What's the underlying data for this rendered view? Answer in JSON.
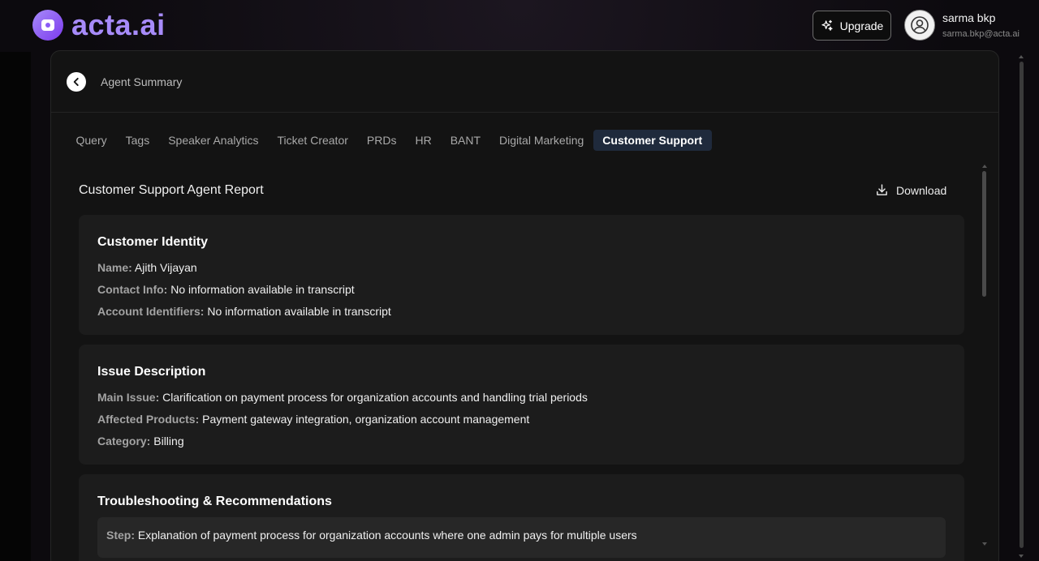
{
  "app": {
    "logo_text": "acta.ai"
  },
  "header": {
    "upgrade_label": "Upgrade",
    "user_name": "sarma bkp",
    "user_email": "sarma.bkp@acta.ai"
  },
  "panel": {
    "title": "Agent Summary",
    "tabs": [
      {
        "label": "Query"
      },
      {
        "label": "Tags"
      },
      {
        "label": "Speaker Analytics"
      },
      {
        "label": "Ticket Creator"
      },
      {
        "label": "PRDs"
      },
      {
        "label": "HR"
      },
      {
        "label": "BANT"
      },
      {
        "label": "Digital Marketing"
      },
      {
        "label": "Customer Support"
      }
    ],
    "active_tab": "Customer Support"
  },
  "report": {
    "title": "Customer Support Agent Report",
    "download_label": "Download",
    "identity": {
      "heading": "Customer Identity",
      "name_label": "Name:",
      "name_value": "Ajith Vijayan",
      "contact_label": "Contact Info:",
      "contact_value": "No information available in transcript",
      "account_label": "Account Identifiers:",
      "account_value": "No information available in transcript"
    },
    "issue": {
      "heading": "Issue Description",
      "main_label": "Main Issue:",
      "main_value": "Clarification on payment process for organization accounts and handling trial periods",
      "products_label": "Affected Products:",
      "products_value": "Payment gateway integration, organization account management",
      "category_label": "Category:",
      "category_value": "Billing"
    },
    "troubleshooting": {
      "heading": "Troubleshooting & Recommendations",
      "step_label": "Step:",
      "step_value": "Explanation of payment process for organization accounts where one admin pays for multiple users"
    }
  },
  "colors": {
    "accent": "#a78bfa",
    "active_tab_bg": "#1f2a3c"
  }
}
